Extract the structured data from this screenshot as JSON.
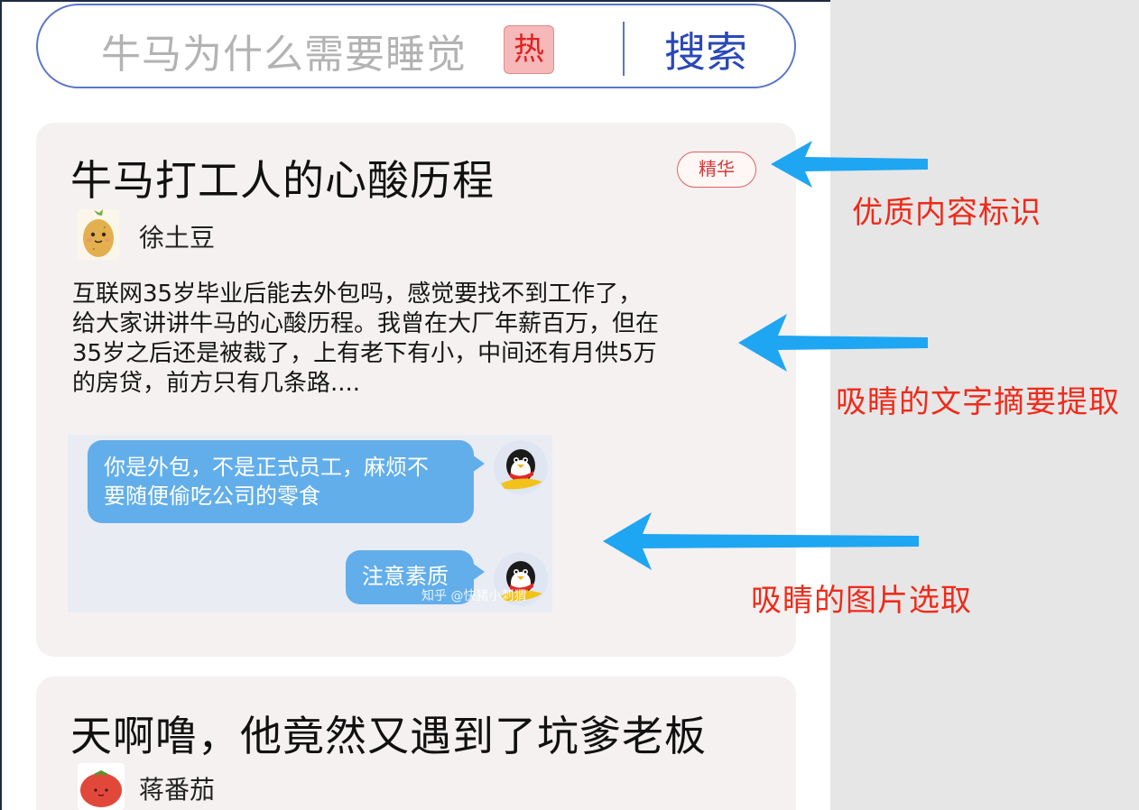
{
  "search": {
    "query": "牛马为什么需要睡觉",
    "hot_badge": "热",
    "button_label": "搜索"
  },
  "feed": {
    "cards": [
      {
        "title": "牛马打工人的心酸历程",
        "badge": "精华",
        "author": "徐土豆",
        "summary_lines": [
          "互联网35岁毕业后能去外包吗，感觉要找不到工作了，",
          "给大家讲讲牛马的心酸历程。我曾在大厂年薪百万，但在",
          "35岁之后还是被裁了，上有老下有小，中间还有月供5万",
          "的房贷，前方只有几条路...."
        ],
        "image": {
          "message_1_lines": [
            "你是外包，不是正式员工，麻烦不",
            "要随便偷吃公司的零食"
          ],
          "message_2": "注意素质",
          "watermark": "知乎 @快猪小刺猬"
        }
      },
      {
        "title": "天啊噜，他竟然又遇到了坑爹老板",
        "author": "蒋番茄"
      }
    ]
  },
  "annotations": {
    "quality_label": "优质内容标识",
    "summary_label": "吸睛的文字摘要提取",
    "image_label": "吸睛的图片选取"
  },
  "colors": {
    "accent_blue": "#2a48b8",
    "annotation_red": "#f02a1a",
    "arrow_blue": "#1fa6f2",
    "bubble_blue": "#62aeea",
    "card_bg": "#f4f1f0"
  }
}
